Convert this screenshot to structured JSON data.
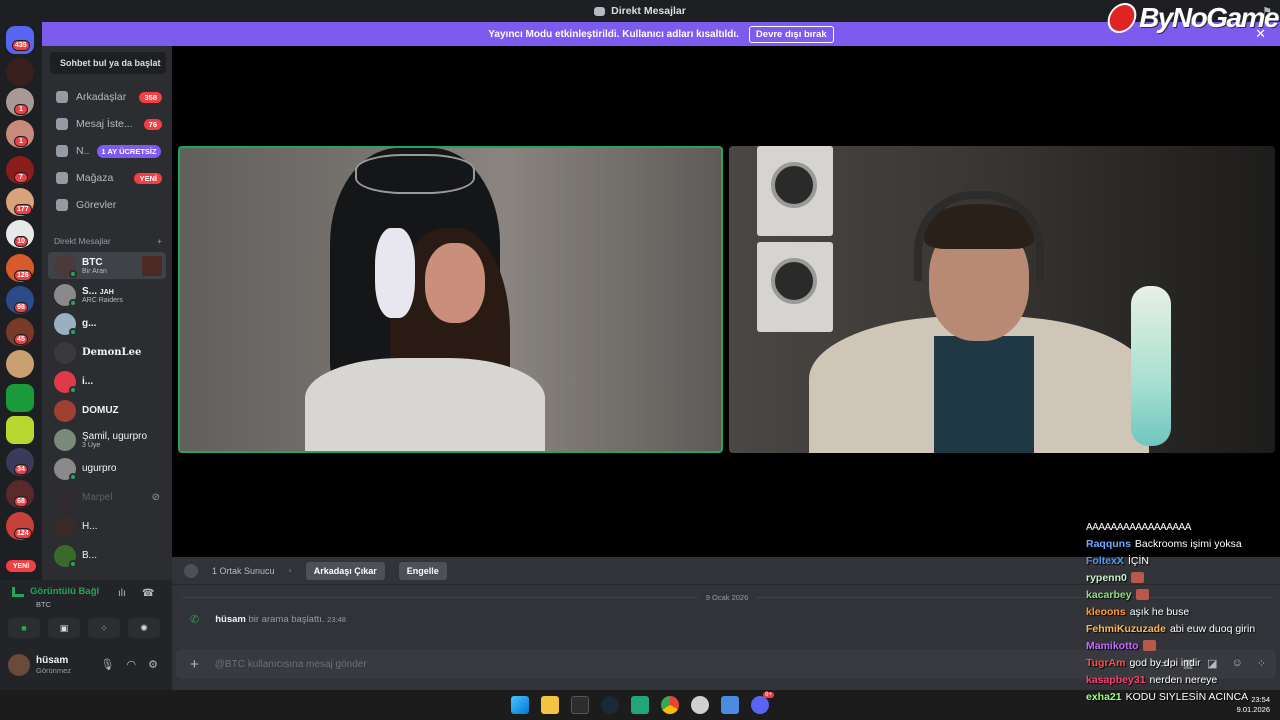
{
  "titlebar": {
    "title": "Direkt Mesajlar"
  },
  "brand": {
    "name": "ByNoGame"
  },
  "banner": {
    "text": "Yayıncı Modu etkinleştirildi. Kullanıcı adları kısaltıldı.",
    "button": "Devre dışı bırak"
  },
  "rail": {
    "badges": [
      "435",
      "1",
      "1",
      "7",
      "177",
      "10",
      "126",
      "98",
      "45",
      "34",
      "68",
      "124"
    ],
    "yeni": "YENİ"
  },
  "sidebar": {
    "search_placeholder": "Sohbet bul ya da başlat",
    "nav": [
      {
        "label": "Arkadaşlar",
        "badge": "358"
      },
      {
        "label": "Mesaj İste...",
        "badge": "76"
      },
      {
        "label": "N..",
        "badge": "1 AY ÜCRETSİZ"
      },
      {
        "label": "Mağaza",
        "badge": "YENİ"
      },
      {
        "label": "Görevler",
        "badge": ""
      }
    ],
    "dm_header": "Direkt Mesajlar",
    "dm_add": "+",
    "dms": [
      {
        "name": "BTC",
        "sub": "Bir Aran"
      },
      {
        "name": "S...",
        "tag": "JAH",
        "sub": "ARC Raiders"
      },
      {
        "name": "g...",
        "sub": ""
      },
      {
        "name": "DemonLee",
        "sub": ""
      },
      {
        "name": "i...",
        "sub": ""
      },
      {
        "name": "DOMUZ",
        "sub": ""
      },
      {
        "name": "Şamil, ugurpro",
        "sub": "3 Üye"
      },
      {
        "name": "ugurpro",
        "sub": ""
      },
      {
        "name": "Marpel",
        "sub": ""
      },
      {
        "name": "H...",
        "sub": ""
      },
      {
        "name": "B...",
        "sub": ""
      }
    ]
  },
  "voice": {
    "status": "Görüntülü Bağl",
    "channel": "BTC"
  },
  "user": {
    "name": "hüsam",
    "status": "Görünmez"
  },
  "chatbar": {
    "mutual": "1 Ortak Sunucu",
    "remove": "Arkadaşı Çıkar",
    "block": "Engelle"
  },
  "chat": {
    "date": "9 Ocak 2026",
    "call": {
      "author": "hüsam",
      "text": "bir arama başlattı.",
      "time": "23:48"
    },
    "input_placeholder": "@BTC kullanıcısına mesaj gönder"
  },
  "stream_chat": {
    "header": "AAAAAAAAAAAAAAAAA",
    "lines": [
      {
        "user": "Raqquns",
        "color": "#6ea8ff",
        "msg": "Backrooms işimi yoksa",
        "emote": false
      },
      {
        "user": "FoltexX",
        "color": "#4a9bff",
        "msg": "İÇİN",
        "emote": false
      },
      {
        "user": "rypenn0",
        "color": "#c9f2c9",
        "msg": "",
        "emote": true
      },
      {
        "user": "kacarbey",
        "color": "#8be07a",
        "msg": "",
        "emote": true
      },
      {
        "user": "kleoons",
        "color": "#ff9a3c",
        "msg": "aşık he buse",
        "emote": false
      },
      {
        "user": "FehmiKuzuzade",
        "color": "#ffb84d",
        "msg": "abi euw duoq girin",
        "emote": false
      },
      {
        "user": "Mamikotto",
        "color": "#c46bff",
        "msg": "",
        "emote": true
      },
      {
        "user": "TugrAm",
        "color": "#ff4d4d",
        "msg": "god by dpi indir",
        "emote": false
      },
      {
        "user": "kasapbey31",
        "color": "#ff3f6f",
        "msg": "nerden nereye",
        "emote": false
      },
      {
        "user": "exha21",
        "color": "#9cff7a",
        "msg": "KODU SIYLESİN ACINCA",
        "emote": false
      }
    ]
  },
  "taskbar": {
    "discord_badge": "9+"
  },
  "clock": {
    "time": "23:54",
    "date": "9.01.2026"
  }
}
